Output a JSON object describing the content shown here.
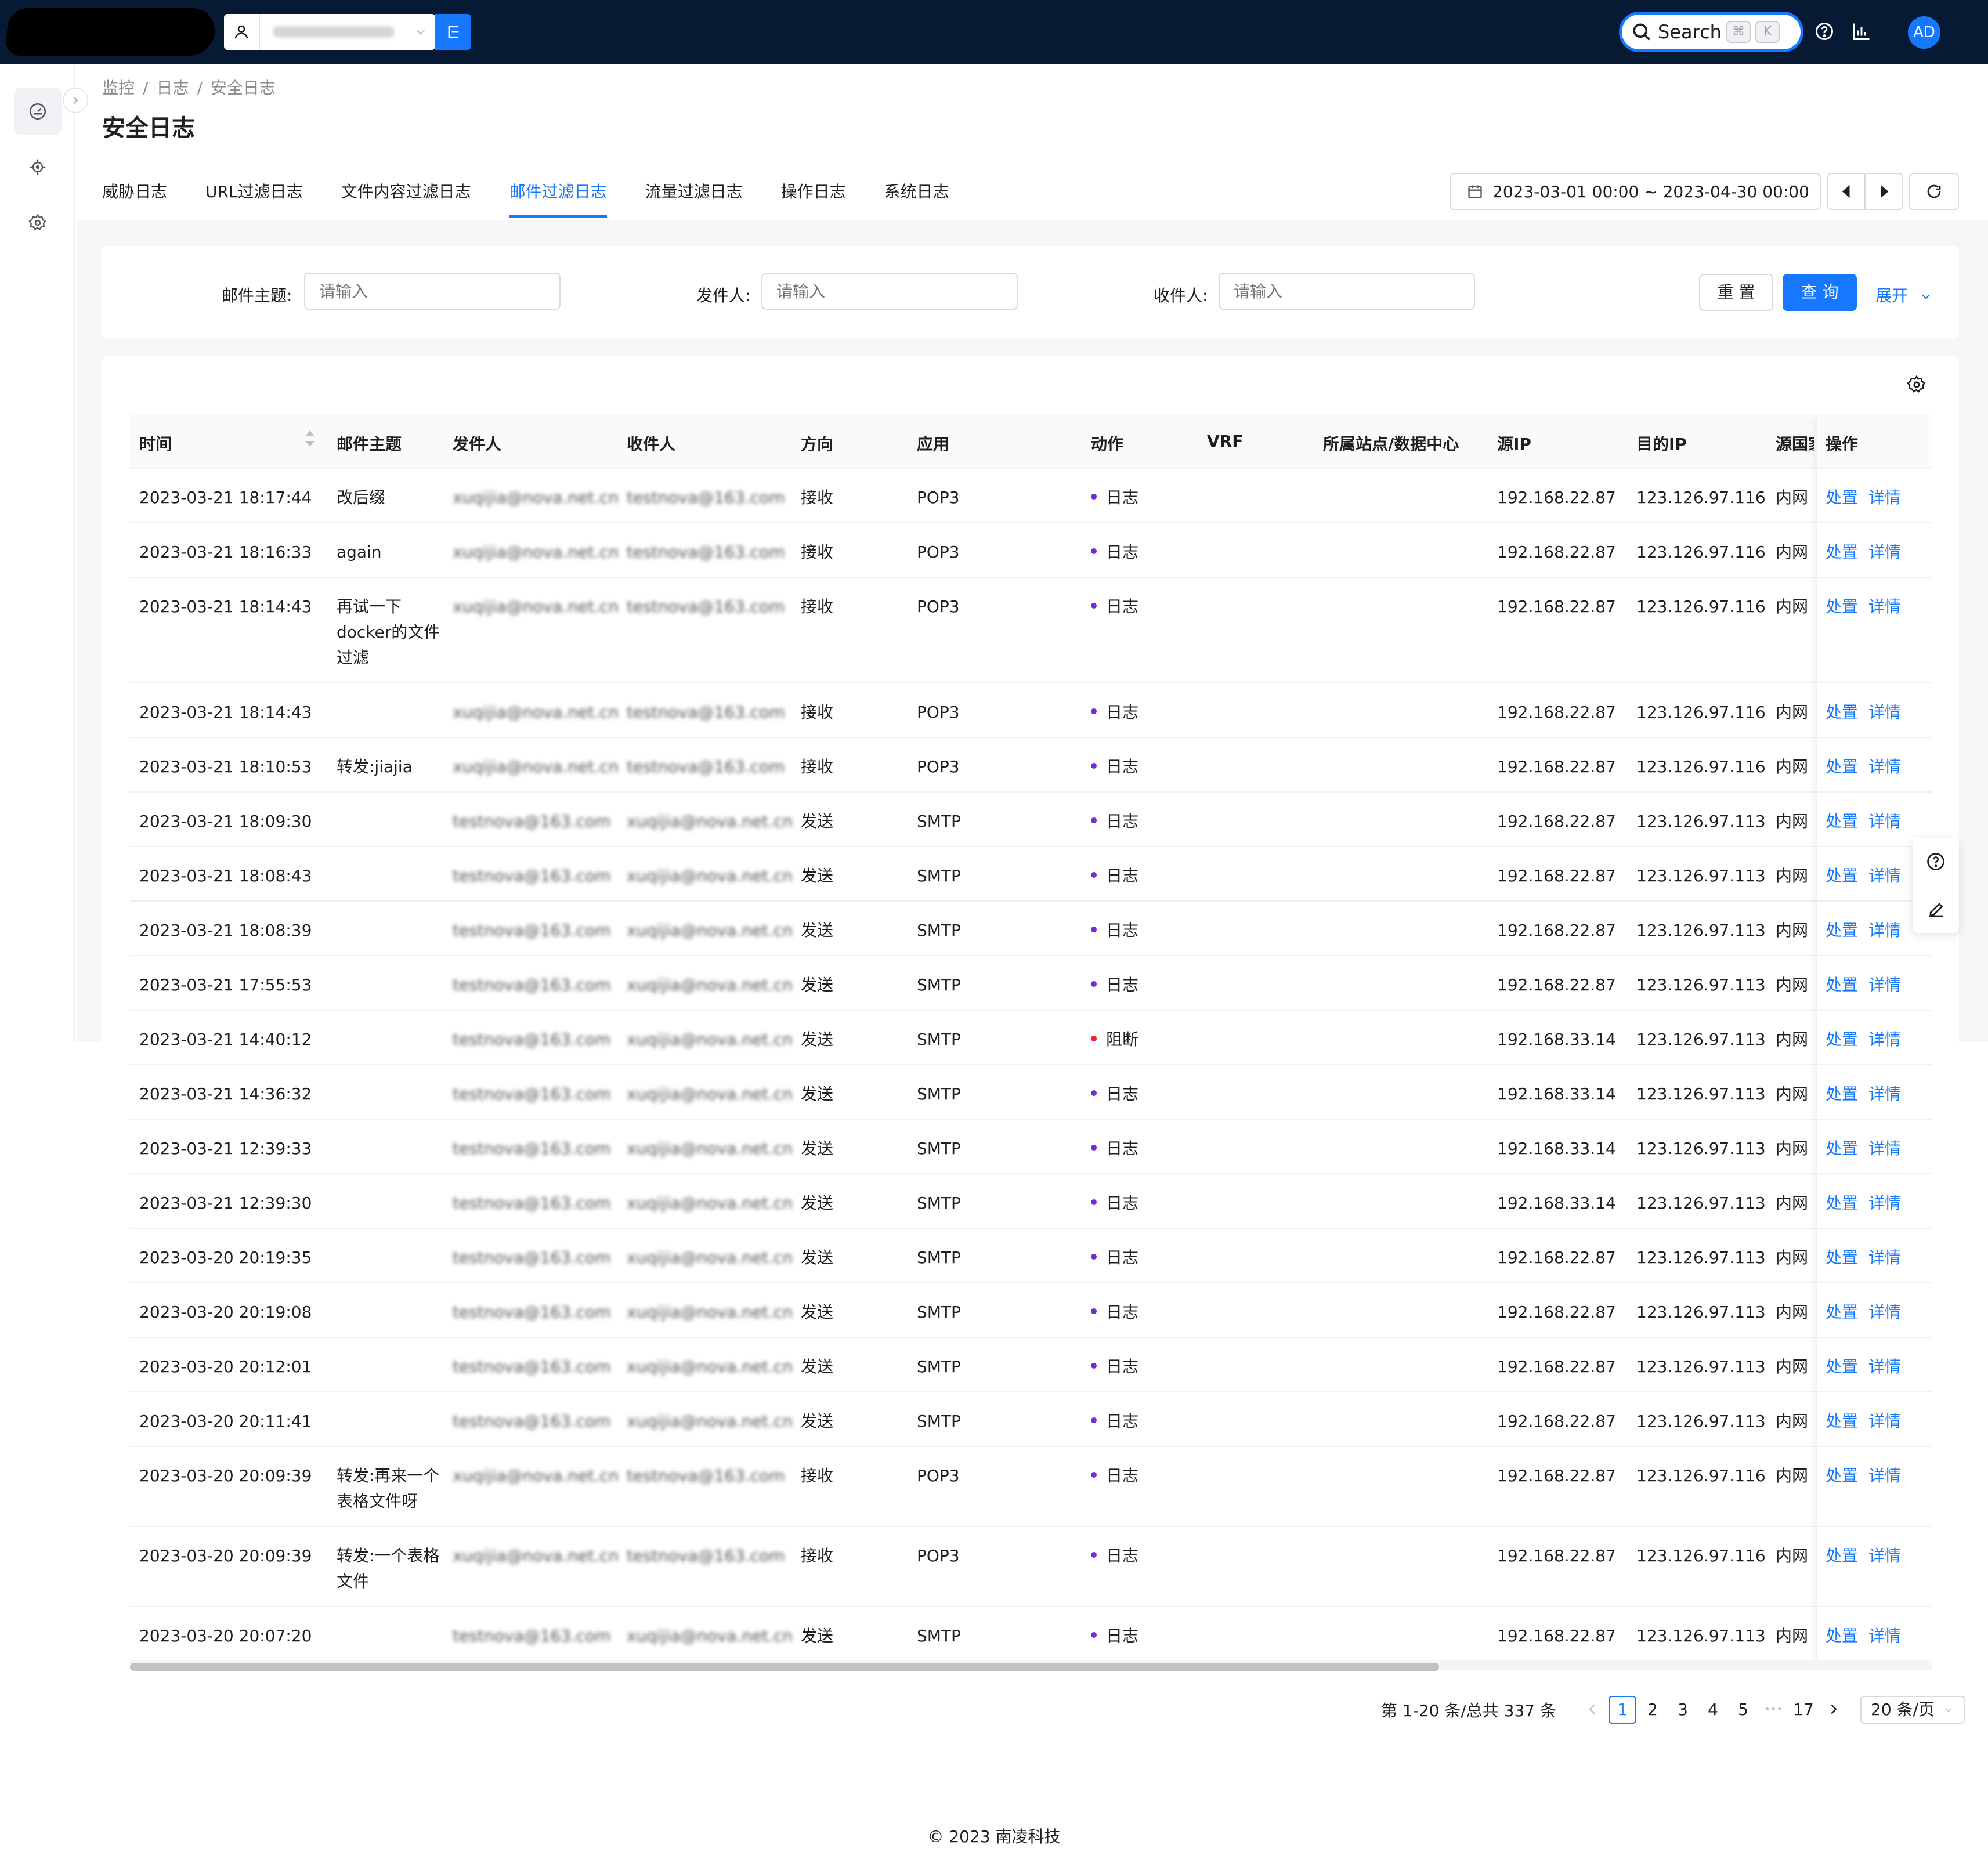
{
  "topbar": {
    "search_label": "Search",
    "kbd_cmd": "⌘",
    "kbd_k": "K",
    "avatar": "AD",
    "icons": [
      "user-icon",
      "chevron-down-icon",
      "switch-icon",
      "search-icon",
      "help-icon",
      "chart-icon"
    ]
  },
  "sidenav": {
    "icons": [
      "dashboard-icon",
      "target-icon",
      "gear-icon",
      "chevron-right-icon"
    ]
  },
  "breadcrumb": [
    "监控",
    "日志",
    "安全日志"
  ],
  "page_title": "安全日志",
  "tabs": [
    "威胁日志",
    "URL过滤日志",
    "文件内容过滤日志",
    "邮件过滤日志",
    "流量过滤日志",
    "操作日志",
    "系统日志"
  ],
  "active_tab": "邮件过滤日志",
  "date_range": "2023-03-01 00:00 ~ 2023-04-30 00:00",
  "filters": {
    "subject_label": "邮件主题:",
    "sender_label": "发件人:",
    "recipient_label": "收件人:",
    "placeholder": "请输入",
    "reset": "重 置",
    "query": "查 询",
    "expand": "展开"
  },
  "table": {
    "columns": [
      "时间",
      "邮件主题",
      "发件人",
      "收件人",
      "方向",
      "应用",
      "动作",
      "VRF",
      "所属站点/数据中心",
      "源IP",
      "目的IP",
      "源国家",
      "操作"
    ],
    "actions": [
      "处置",
      "详情"
    ],
    "rows": [
      {
        "time": "2023-03-21 18:17:44",
        "subject": "改后缀",
        "sender": "xuqijia@nova.net.cn",
        "recipient": "testnova@163.com",
        "direction": "接收",
        "app": "POP3",
        "action": "日志",
        "src_ip": "192.168.22.87",
        "dst_ip": "123.126.97.116",
        "country": "内网"
      },
      {
        "time": "2023-03-21 18:16:33",
        "subject": "again",
        "sender": "xuqijia@nova.net.cn",
        "recipient": "testnova@163.com",
        "direction": "接收",
        "app": "POP3",
        "action": "日志",
        "src_ip": "192.168.22.87",
        "dst_ip": "123.126.97.116",
        "country": "内网"
      },
      {
        "time": "2023-03-21 18:14:43",
        "subject": "再试一下docker的文件过滤",
        "sender": "xuqijia@nova.net.cn",
        "recipient": "testnova@163.com",
        "direction": "接收",
        "app": "POP3",
        "action": "日志",
        "src_ip": "192.168.22.87",
        "dst_ip": "123.126.97.116",
        "country": "内网"
      },
      {
        "time": "2023-03-21 18:14:43",
        "subject": "",
        "sender": "xuqijia@nova.net.cn",
        "recipient": "testnova@163.com",
        "direction": "接收",
        "app": "POP3",
        "action": "日志",
        "src_ip": "192.168.22.87",
        "dst_ip": "123.126.97.116",
        "country": "内网"
      },
      {
        "time": "2023-03-21 18:10:53",
        "subject": "转发:jiajia",
        "sender": "xuqijia@nova.net.cn",
        "recipient": "testnova@163.com",
        "direction": "接收",
        "app": "POP3",
        "action": "日志",
        "src_ip": "192.168.22.87",
        "dst_ip": "123.126.97.116",
        "country": "内网"
      },
      {
        "time": "2023-03-21 18:09:30",
        "subject": "",
        "sender": "testnova@163.com",
        "recipient": "xuqijia@nova.net.cn",
        "direction": "发送",
        "app": "SMTP",
        "action": "日志",
        "src_ip": "192.168.22.87",
        "dst_ip": "123.126.97.113",
        "country": "内网"
      },
      {
        "time": "2023-03-21 18:08:43",
        "subject": "",
        "sender": "testnova@163.com",
        "recipient": "xuqijia@nova.net.cn",
        "direction": "发送",
        "app": "SMTP",
        "action": "日志",
        "src_ip": "192.168.22.87",
        "dst_ip": "123.126.97.113",
        "country": "内网"
      },
      {
        "time": "2023-03-21 18:08:39",
        "subject": "",
        "sender": "testnova@163.com",
        "recipient": "xuqijia@nova.net.cn",
        "direction": "发送",
        "app": "SMTP",
        "action": "日志",
        "src_ip": "192.168.22.87",
        "dst_ip": "123.126.97.113",
        "country": "内网"
      },
      {
        "time": "2023-03-21 17:55:53",
        "subject": "",
        "sender": "testnova@163.com",
        "recipient": "xuqijia@nova.net.cn",
        "direction": "发送",
        "app": "SMTP",
        "action": "日志",
        "src_ip": "192.168.22.87",
        "dst_ip": "123.126.97.113",
        "country": "内网"
      },
      {
        "time": "2023-03-21 14:40:12",
        "subject": "",
        "sender": "testnova@163.com",
        "recipient": "xuqijia@nova.net.cn",
        "direction": "发送",
        "app": "SMTP",
        "action": "阻断",
        "src_ip": "192.168.33.14",
        "dst_ip": "123.126.97.113",
        "country": "内网"
      },
      {
        "time": "2023-03-21 14:36:32",
        "subject": "",
        "sender": "testnova@163.com",
        "recipient": "xuqijia@nova.net.cn",
        "direction": "发送",
        "app": "SMTP",
        "action": "日志",
        "src_ip": "192.168.33.14",
        "dst_ip": "123.126.97.113",
        "country": "内网"
      },
      {
        "time": "2023-03-21 12:39:33",
        "subject": "",
        "sender": "testnova@163.com",
        "recipient": "xuqijia@nova.net.cn",
        "direction": "发送",
        "app": "SMTP",
        "action": "日志",
        "src_ip": "192.168.33.14",
        "dst_ip": "123.126.97.113",
        "country": "内网"
      },
      {
        "time": "2023-03-21 12:39:30",
        "subject": "",
        "sender": "testnova@163.com",
        "recipient": "xuqijia@nova.net.cn",
        "direction": "发送",
        "app": "SMTP",
        "action": "日志",
        "src_ip": "192.168.33.14",
        "dst_ip": "123.126.97.113",
        "country": "内网"
      },
      {
        "time": "2023-03-20 20:19:35",
        "subject": "",
        "sender": "testnova@163.com",
        "recipient": "xuqijia@nova.net.cn",
        "direction": "发送",
        "app": "SMTP",
        "action": "日志",
        "src_ip": "192.168.22.87",
        "dst_ip": "123.126.97.113",
        "country": "内网"
      },
      {
        "time": "2023-03-20 20:19:08",
        "subject": "",
        "sender": "testnova@163.com",
        "recipient": "xuqijia@nova.net.cn",
        "direction": "发送",
        "app": "SMTP",
        "action": "日志",
        "src_ip": "192.168.22.87",
        "dst_ip": "123.126.97.113",
        "country": "内网"
      },
      {
        "time": "2023-03-20 20:12:01",
        "subject": "",
        "sender": "testnova@163.com",
        "recipient": "xuqijia@nova.net.cn",
        "direction": "发送",
        "app": "SMTP",
        "action": "日志",
        "src_ip": "192.168.22.87",
        "dst_ip": "123.126.97.113",
        "country": "内网"
      },
      {
        "time": "2023-03-20 20:11:41",
        "subject": "",
        "sender": "testnova@163.com",
        "recipient": "xuqijia@nova.net.cn",
        "direction": "发送",
        "app": "SMTP",
        "action": "日志",
        "src_ip": "192.168.22.87",
        "dst_ip": "123.126.97.113",
        "country": "内网"
      },
      {
        "time": "2023-03-20 20:09:39",
        "subject": "转发:再来一个表格文件呀",
        "sender": "xuqijia@nova.net.cn",
        "recipient": "testnova@163.com",
        "direction": "接收",
        "app": "POP3",
        "action": "日志",
        "src_ip": "192.168.22.87",
        "dst_ip": "123.126.97.116",
        "country": "内网"
      },
      {
        "time": "2023-03-20 20:09:39",
        "subject": "转发:一个表格文件",
        "sender": "xuqijia@nova.net.cn",
        "recipient": "testnova@163.com",
        "direction": "接收",
        "app": "POP3",
        "action": "日志",
        "src_ip": "192.168.22.87",
        "dst_ip": "123.126.97.116",
        "country": "内网"
      },
      {
        "time": "2023-03-20 20:07:20",
        "subject": "",
        "sender": "testnova@163.com",
        "recipient": "xuqijia@nova.net.cn",
        "direction": "发送",
        "app": "SMTP",
        "action": "日志",
        "src_ip": "192.168.22.87",
        "dst_ip": "123.126.97.113",
        "country": "内网"
      }
    ]
  },
  "pagination": {
    "total_text": "第 1-20 条/总共 337 条",
    "pages": [
      "1",
      "2",
      "3",
      "4",
      "5",
      "•••",
      "17"
    ],
    "current": "1",
    "page_size": "20 条/页"
  },
  "footer": "© 2023 南凌科技",
  "colors": {
    "primary": "#1677ff",
    "topbar": "#071a33",
    "log_dot": "#722ed1",
    "block_dot": "#f5222d"
  }
}
